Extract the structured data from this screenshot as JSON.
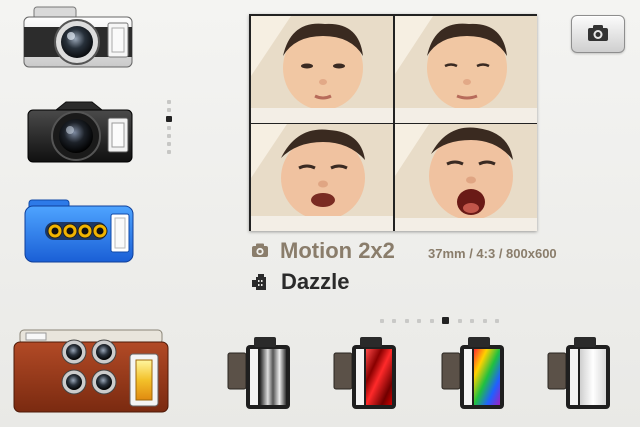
{
  "cameras": [
    {
      "name": "classic-silver-camera",
      "selected": false
    },
    {
      "name": "black-slr-camera",
      "selected": true
    },
    {
      "name": "blue-multi-lens-camera",
      "selected": false
    }
  ],
  "current_camera": {
    "name": "red-four-lens-camera"
  },
  "camera_pages": {
    "count": 8,
    "active": 3
  },
  "preview": {
    "grid": "2x2",
    "frames": 4
  },
  "mode": {
    "icon": "camera-icon",
    "title": "Motion 2x2",
    "specs": "37mm / 4:3 / 800x600"
  },
  "film": {
    "icon": "film-canister-icon",
    "name": "Dazzle"
  },
  "film_pages": {
    "count": 8,
    "active": 6
  },
  "films": [
    {
      "name": "film-roll-grayscale",
      "colors": [
        "#222222",
        "#ffffff"
      ]
    },
    {
      "name": "film-roll-red",
      "colors": [
        "#b00000",
        "#ff3b3b"
      ]
    },
    {
      "name": "film-roll-rainbow",
      "colors": [
        "#ff2d2d",
        "#ffd100",
        "#20c040",
        "#2060ff",
        "#a020c0"
      ]
    },
    {
      "name": "film-roll-white",
      "colors": [
        "#e8e8e8",
        "#ffffff"
      ]
    }
  ],
  "shutter": {
    "icon": "camera-icon"
  }
}
